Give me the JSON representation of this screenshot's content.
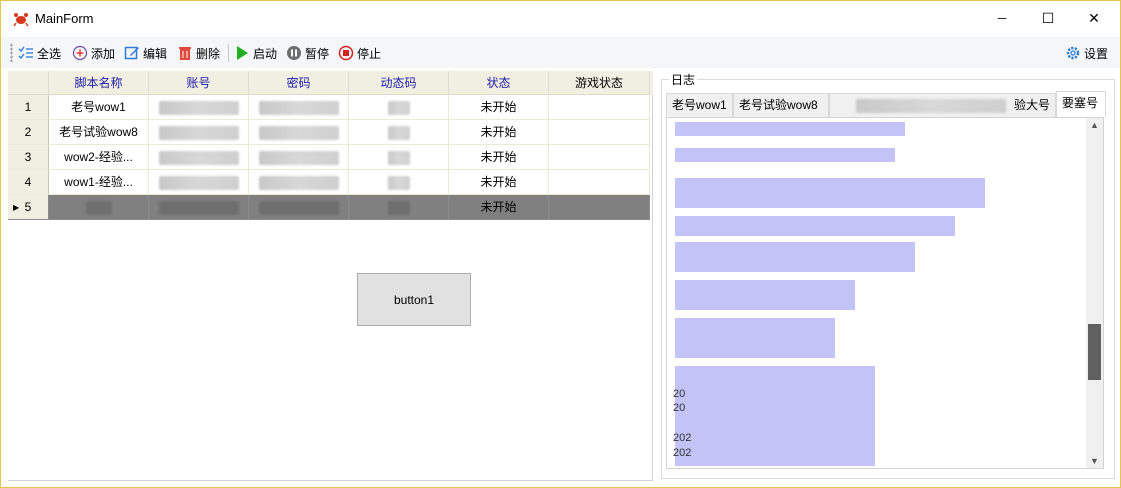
{
  "window": {
    "title": "MainForm",
    "minimize_glyph": "─",
    "maximize_glyph": "☐",
    "close_glyph": "✕"
  },
  "toolbar": {
    "select_all": "全选",
    "add": "添加",
    "edit": "编辑",
    "delete": "删除",
    "start": "启动",
    "pause": "暂停",
    "stop": "停止",
    "settings": "设置"
  },
  "grid": {
    "columns": [
      "脚本名称",
      "账号",
      "密码",
      "动态码",
      "状态",
      "游戏状态"
    ],
    "rows": [
      {
        "index": "1",
        "name": "老号wow1",
        "status": "未开始",
        "game_status": ""
      },
      {
        "index": "2",
        "name": "老号试验wow8",
        "status": "未开始",
        "game_status": ""
      },
      {
        "index": "3",
        "name": "wow2-经验...",
        "status": "未开始",
        "game_status": ""
      },
      {
        "index": "4",
        "name": "wow1-经验...",
        "status": "未开始",
        "game_status": ""
      },
      {
        "index": "5",
        "name": "",
        "status": "未开始",
        "game_status": ""
      }
    ],
    "selected_row": 5
  },
  "button1": {
    "label": "button1"
  },
  "log": {
    "legend": "日志",
    "tabs": [
      "老号wow1",
      "老号试验wow8",
      "验大号",
      "要塞号"
    ],
    "active_tab": "要塞号",
    "lines": [
      "20",
      "20",
      "20",
      "202",
      "202"
    ]
  },
  "colors": {
    "header_text": "#1a1aa8",
    "selected_row": "#808080",
    "accent": "#2b7bd8"
  }
}
